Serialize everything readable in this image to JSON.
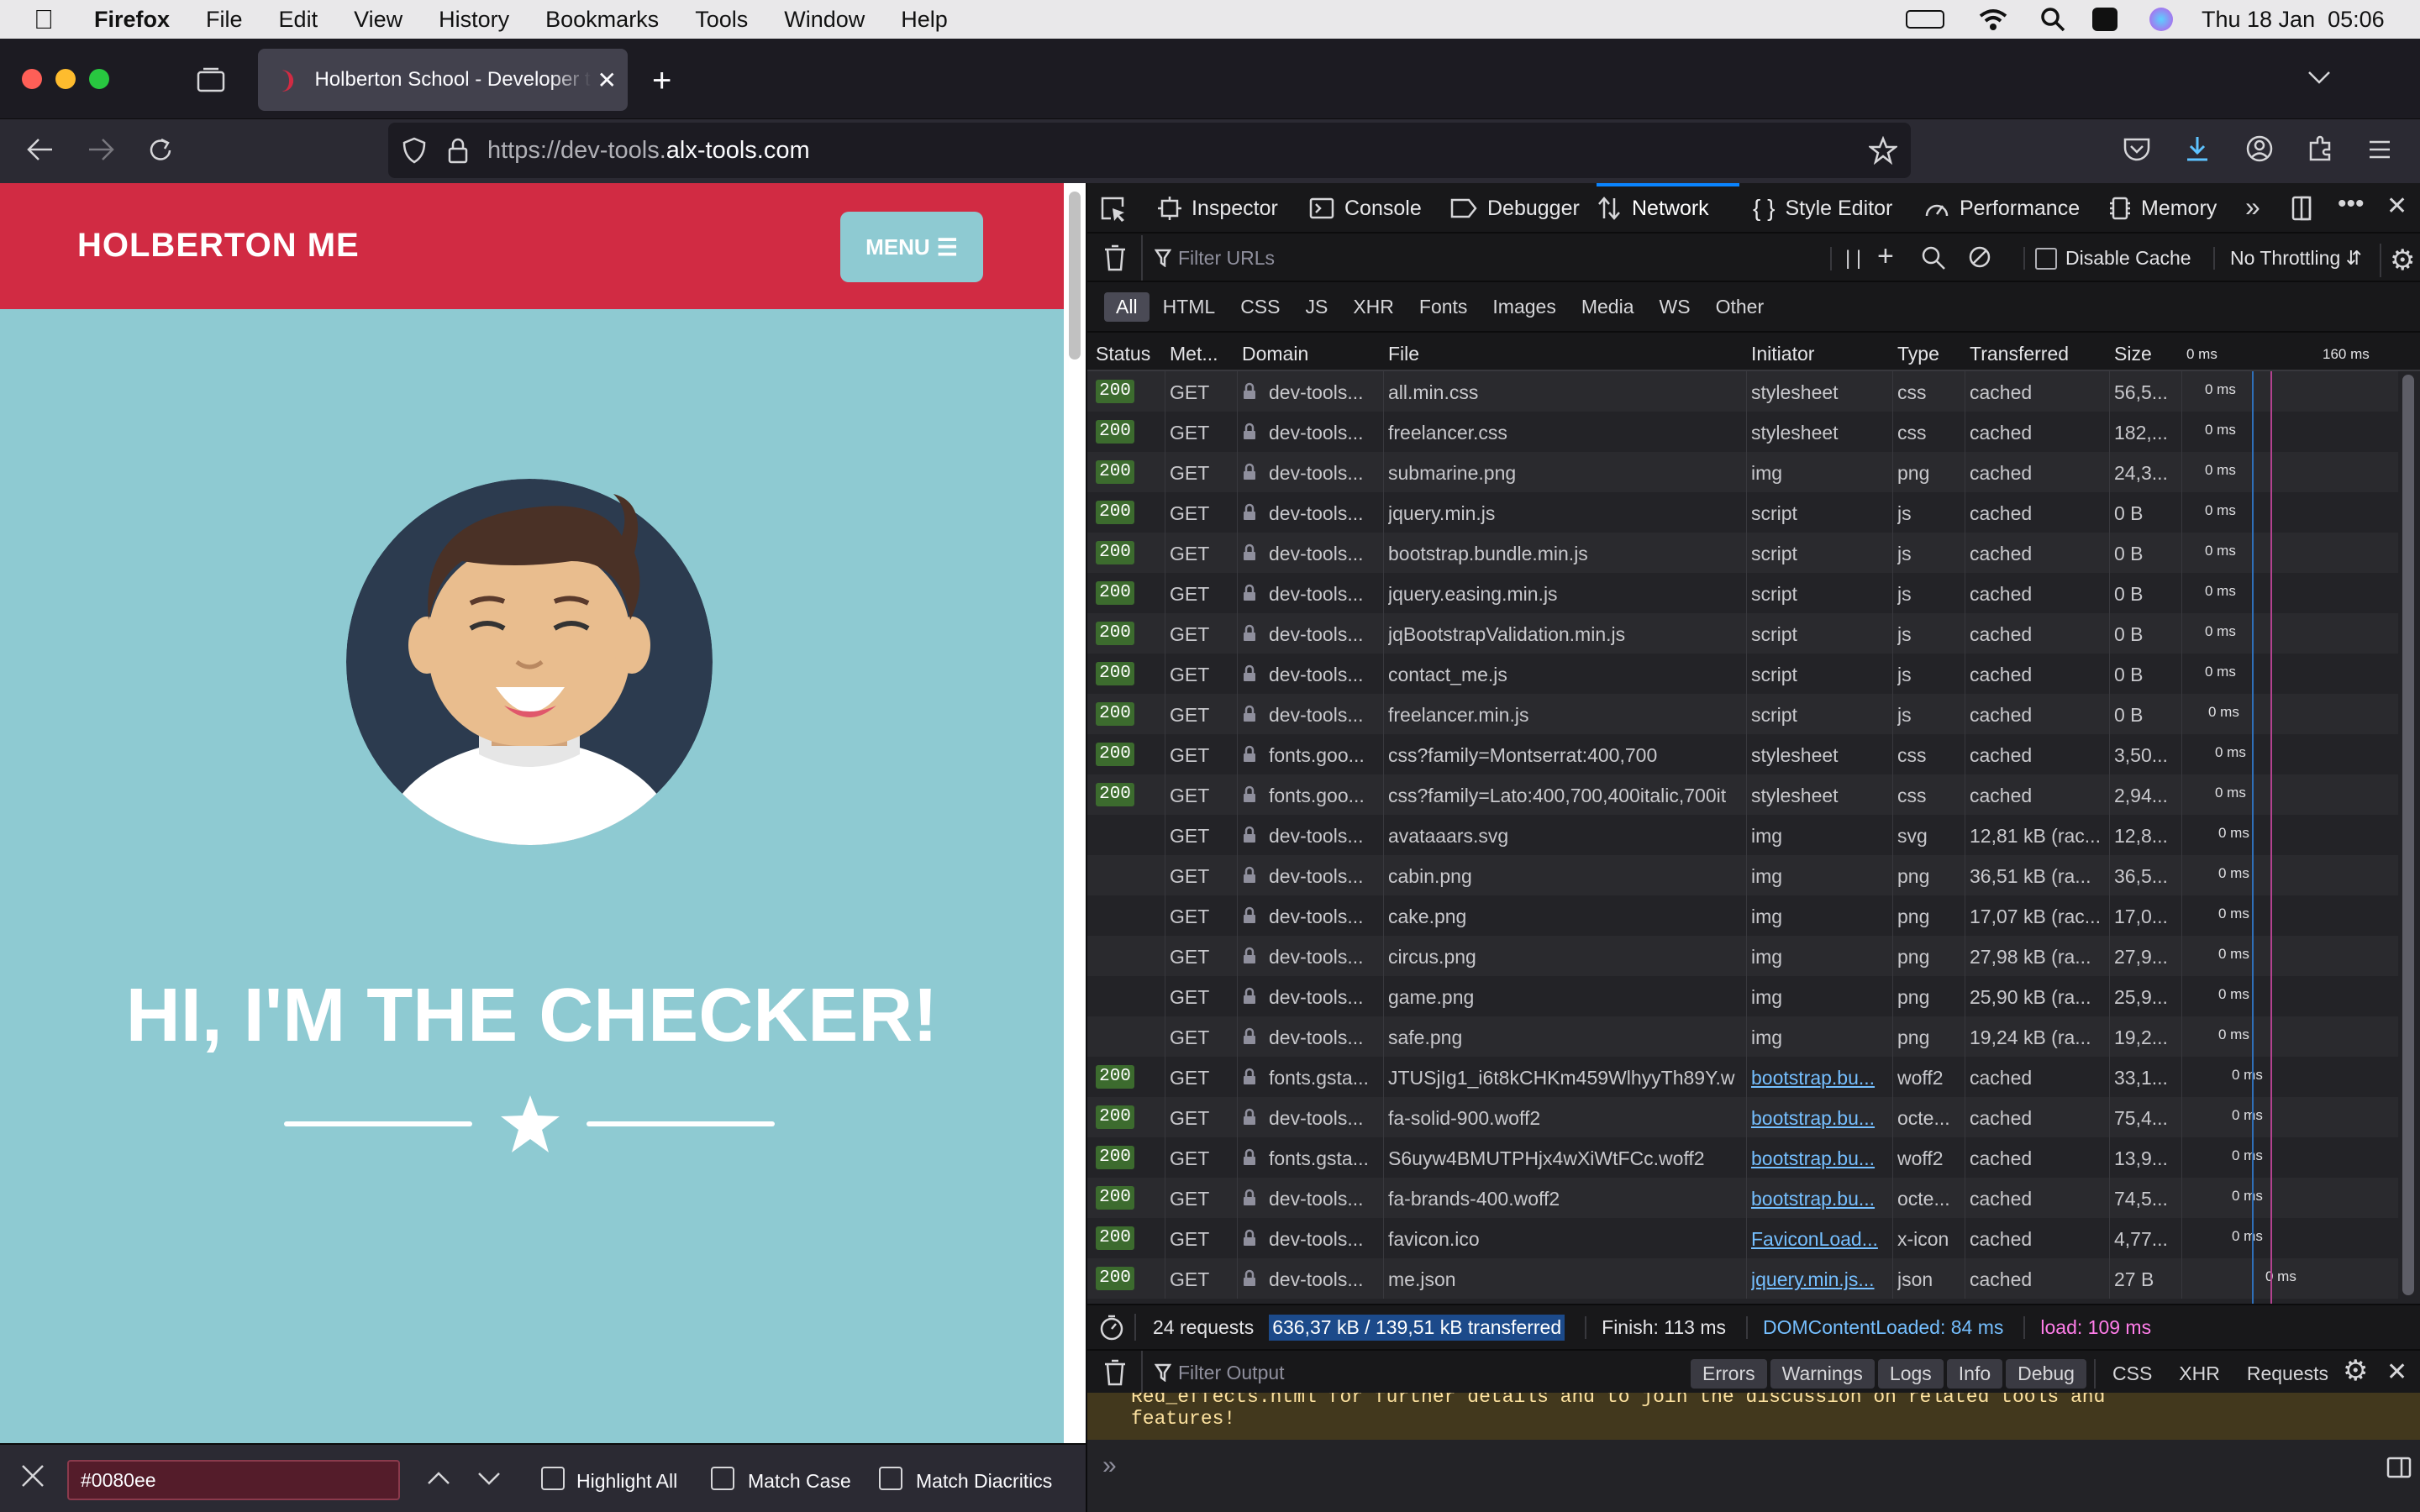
{
  "menubar": {
    "app": "Firefox",
    "items": [
      "File",
      "Edit",
      "View",
      "History",
      "Bookmarks",
      "Tools",
      "Window",
      "Help"
    ],
    "clock": "Thu 18 Jan  05:06"
  },
  "browser": {
    "tab_title": "Holberton School - Developer to",
    "url_prefix": "https://dev-tools.",
    "url_domain": "alx-tools.com"
  },
  "page": {
    "brand": "HOLBERTON ME",
    "menu_label": "MENU",
    "headline": "HI, I'M THE CHECKER!",
    "colors": {
      "header": "#d12b43",
      "background": "#8ecad2",
      "button": "#8ecad2"
    }
  },
  "devtools": {
    "tabs": [
      "Inspector",
      "Console",
      "Debugger",
      "Network",
      "Style Editor",
      "Performance",
      "Memory"
    ],
    "active_tab": "Network",
    "filter_placeholder": "Filter URLs",
    "disable_cache": "Disable Cache",
    "throttling": "No Throttling",
    "type_filters": [
      "All",
      "HTML",
      "CSS",
      "JS",
      "XHR",
      "Fonts",
      "Images",
      "Media",
      "WS",
      "Other"
    ],
    "columns": [
      "Status",
      "Met...",
      "Domain",
      "File",
      "Initiator",
      "Type",
      "Transferred",
      "Size",
      "0 ms",
      "160 ms"
    ],
    "requests": [
      {
        "status": "200",
        "method": "GET",
        "domain": "dev-tools...",
        "file": "all.min.css",
        "initiator": "stylesheet",
        "type": "css",
        "transferred": "cached",
        "size": "56,5...",
        "timing": "0 ms"
      },
      {
        "status": "200",
        "method": "GET",
        "domain": "dev-tools...",
        "file": "freelancer.css",
        "initiator": "stylesheet",
        "type": "css",
        "transferred": "cached",
        "size": "182,...",
        "timing": "0 ms"
      },
      {
        "status": "200",
        "method": "GET",
        "domain": "dev-tools...",
        "file": "submarine.png",
        "initiator": "img",
        "type": "png",
        "transferred": "cached",
        "size": "24,3...",
        "timing": "0 ms"
      },
      {
        "status": "200",
        "method": "GET",
        "domain": "dev-tools...",
        "file": "jquery.min.js",
        "initiator": "script",
        "type": "js",
        "transferred": "cached",
        "size": "0 B",
        "timing": "0 ms"
      },
      {
        "status": "200",
        "method": "GET",
        "domain": "dev-tools...",
        "file": "bootstrap.bundle.min.js",
        "initiator": "script",
        "type": "js",
        "transferred": "cached",
        "size": "0 B",
        "timing": "0 ms"
      },
      {
        "status": "200",
        "method": "GET",
        "domain": "dev-tools...",
        "file": "jquery.easing.min.js",
        "initiator": "script",
        "type": "js",
        "transferred": "cached",
        "size": "0 B",
        "timing": "0 ms"
      },
      {
        "status": "200",
        "method": "GET",
        "domain": "dev-tools...",
        "file": "jqBootstrapValidation.min.js",
        "initiator": "script",
        "type": "js",
        "transferred": "cached",
        "size": "0 B",
        "timing": "0 ms"
      },
      {
        "status": "200",
        "method": "GET",
        "domain": "dev-tools...",
        "file": "contact_me.js",
        "initiator": "script",
        "type": "js",
        "transferred": "cached",
        "size": "0 B",
        "timing": "0 ms"
      },
      {
        "status": "200",
        "method": "GET",
        "domain": "dev-tools...",
        "file": "freelancer.min.js",
        "initiator": "script",
        "type": "js",
        "transferred": "cached",
        "size": "0 B",
        "timing": "0 ms"
      },
      {
        "status": "200",
        "method": "GET",
        "domain": "fonts.goo...",
        "file": "css?family=Montserrat:400,700",
        "initiator": "stylesheet",
        "type": "css",
        "transferred": "cached",
        "size": "3,50...",
        "timing": "0 ms"
      },
      {
        "status": "200",
        "method": "GET",
        "domain": "fonts.goo...",
        "file": "css?family=Lato:400,700,400italic,700it",
        "initiator": "stylesheet",
        "type": "css",
        "transferred": "cached",
        "size": "2,94...",
        "timing": "0 ms"
      },
      {
        "status": "",
        "method": "GET",
        "domain": "dev-tools...",
        "file": "avataaars.svg",
        "initiator": "img",
        "type": "svg",
        "transferred": "12,81 kB (rac...",
        "size": "12,8...",
        "timing": "0 ms"
      },
      {
        "status": "",
        "method": "GET",
        "domain": "dev-tools...",
        "file": "cabin.png",
        "initiator": "img",
        "type": "png",
        "transferred": "36,51 kB (ra...",
        "size": "36,5...",
        "timing": "0 ms"
      },
      {
        "status": "",
        "method": "GET",
        "domain": "dev-tools...",
        "file": "cake.png",
        "initiator": "img",
        "type": "png",
        "transferred": "17,07 kB (rac...",
        "size": "17,0...",
        "timing": "0 ms"
      },
      {
        "status": "",
        "method": "GET",
        "domain": "dev-tools...",
        "file": "circus.png",
        "initiator": "img",
        "type": "png",
        "transferred": "27,98 kB (ra...",
        "size": "27,9...",
        "timing": "0 ms"
      },
      {
        "status": "",
        "method": "GET",
        "domain": "dev-tools...",
        "file": "game.png",
        "initiator": "img",
        "type": "png",
        "transferred": "25,90 kB (ra...",
        "size": "25,9...",
        "timing": "0 ms"
      },
      {
        "status": "",
        "method": "GET",
        "domain": "dev-tools...",
        "file": "safe.png",
        "initiator": "img",
        "type": "png",
        "transferred": "19,24 kB (ra...",
        "size": "19,2...",
        "timing": "0 ms"
      },
      {
        "status": "200",
        "method": "GET",
        "domain": "fonts.gsta...",
        "file": "JTUSjIg1_i6t8kCHKm459WlhyyTh89Y.w",
        "initiator": "bootstrap.bu...",
        "type": "woff2",
        "transferred": "cached",
        "size": "33,1...",
        "timing": "0 ms",
        "link": true
      },
      {
        "status": "200",
        "method": "GET",
        "domain": "dev-tools...",
        "file": "fa-solid-900.woff2",
        "initiator": "bootstrap.bu...",
        "type": "octe...",
        "transferred": "cached",
        "size": "75,4...",
        "timing": "0 ms",
        "link": true
      },
      {
        "status": "200",
        "method": "GET",
        "domain": "fonts.gsta...",
        "file": "S6uyw4BMUTPHjx4wXiWtFCc.woff2",
        "initiator": "bootstrap.bu...",
        "type": "woff2",
        "transferred": "cached",
        "size": "13,9...",
        "timing": "0 ms",
        "link": true
      },
      {
        "status": "200",
        "method": "GET",
        "domain": "dev-tools...",
        "file": "fa-brands-400.woff2",
        "initiator": "bootstrap.bu...",
        "type": "octe...",
        "transferred": "cached",
        "size": "74,5...",
        "timing": "0 ms",
        "link": true
      },
      {
        "status": "200",
        "method": "GET",
        "domain": "dev-tools...",
        "file": "favicon.ico",
        "initiator": "FaviconLoad...",
        "type": "x-icon",
        "transferred": "cached",
        "size": "4,77...",
        "timing": "0 ms",
        "link": true
      },
      {
        "status": "200",
        "method": "GET",
        "domain": "dev-tools...",
        "file": "me.json",
        "initiator": "jquery.min.js...",
        "type": "json",
        "transferred": "cached",
        "size": "27 B",
        "timing": "0 ms",
        "link": true
      }
    ],
    "summary": {
      "requests": "24 requests",
      "transferred": "636,37 kB / 139,51 kB transferred",
      "finish": "Finish: 113 ms",
      "dcl": "DOMContentLoaded: 84 ms",
      "load": "load: 109 ms"
    },
    "console": {
      "filter_placeholder": "Filter Output",
      "levels": [
        "Errors",
        "Warnings",
        "Logs",
        "Info",
        "Debug"
      ],
      "extras": [
        "CSS",
        "XHR",
        "Requests"
      ],
      "message_line1": "Red_effects.html for further details and to join the discussion on related tools and",
      "message_line2": "features!"
    }
  },
  "findbar": {
    "value": "#0080ee",
    "highlight_all": "Highlight All",
    "match_case": "Match Case",
    "match_diacritics": "Match Diacritics"
  }
}
